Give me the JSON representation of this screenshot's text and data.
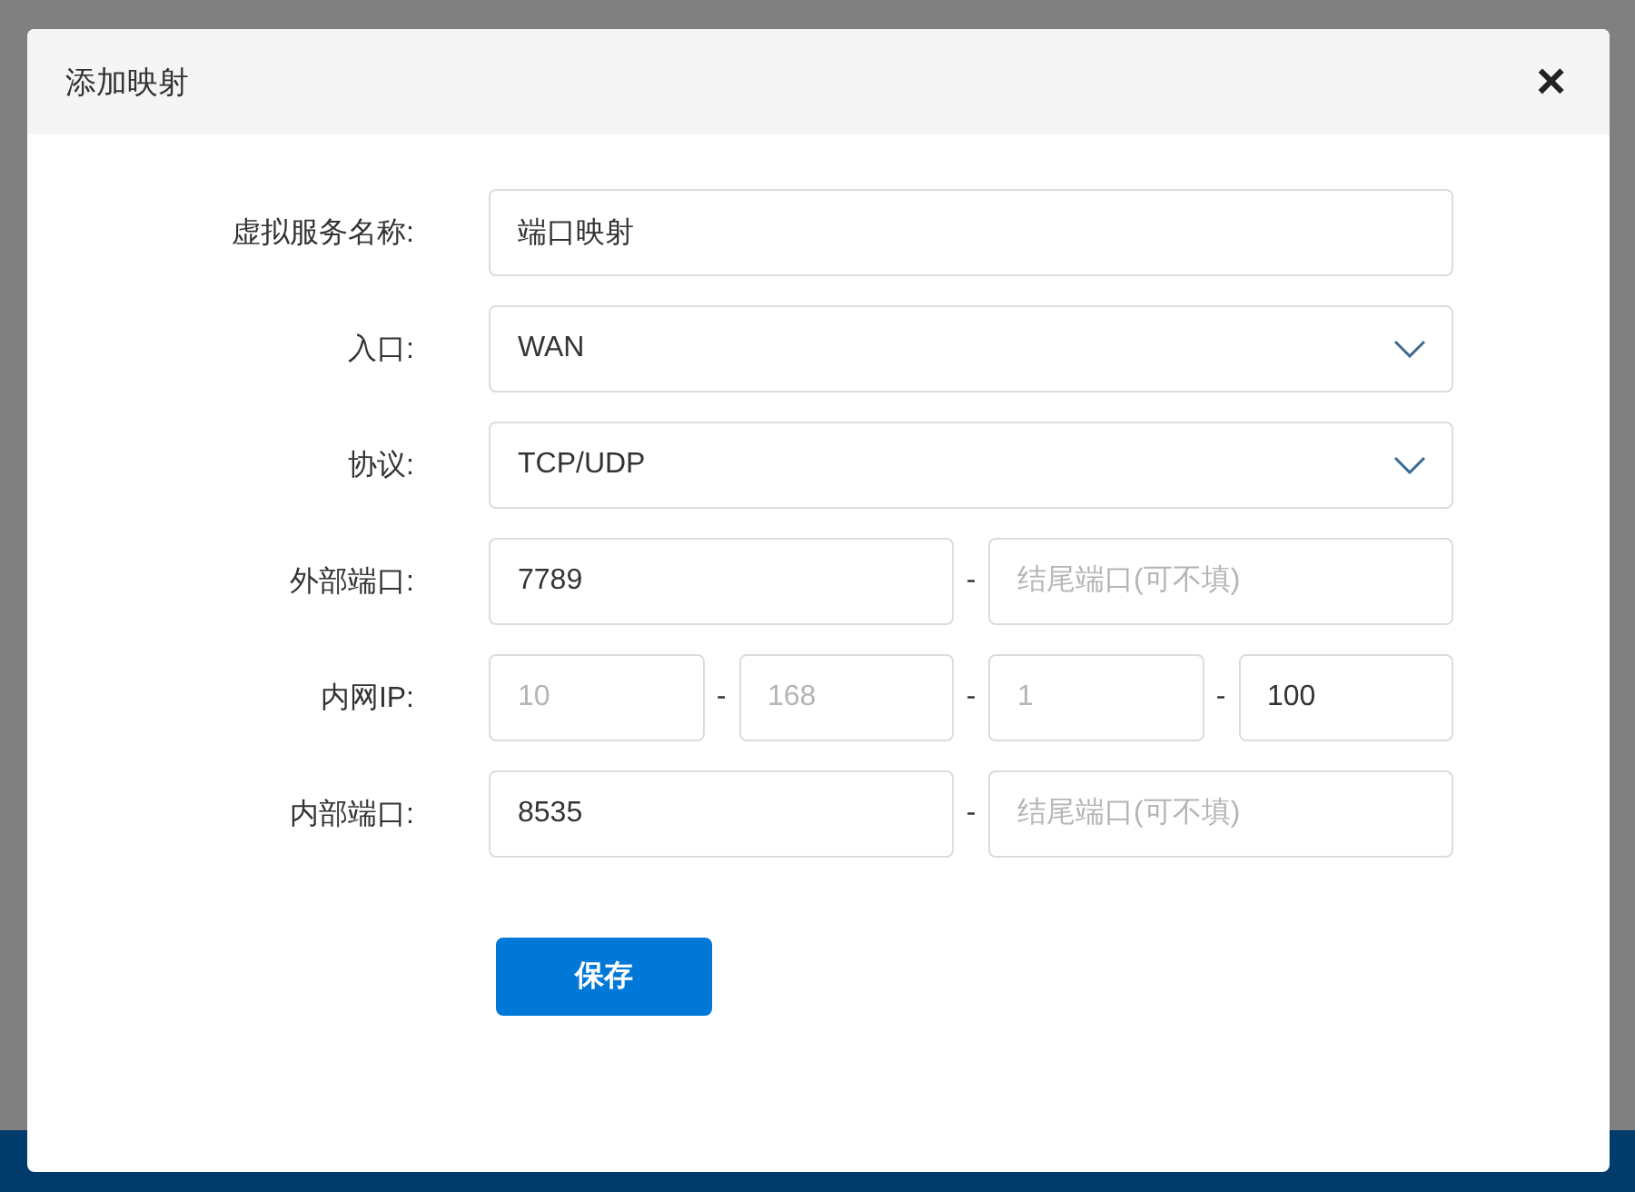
{
  "dialog": {
    "title": "添加映射",
    "close": "×"
  },
  "fields": [
    {
      "kind": "text",
      "label": "虚拟服务名称:",
      "value": "端口映射"
    },
    {
      "kind": "select",
      "label": "入口:",
      "value": "WAN"
    },
    {
      "kind": "select",
      "label": "协议:",
      "value": "TCP/UDP"
    },
    {
      "kind": "range",
      "label": "外部端口:",
      "separator": "-",
      "start": {
        "value": "7789"
      },
      "end": {
        "placeholder": "结尾端口(可不填)"
      }
    },
    {
      "kind": "ip",
      "label": "内网IP:",
      "separator": "-",
      "octets": [
        {
          "placeholder": "10"
        },
        {
          "placeholder": "168"
        },
        {
          "placeholder": "1"
        },
        {
          "value": "100"
        }
      ]
    },
    {
      "kind": "range",
      "label": "内部端口:",
      "separator": "-",
      "start": {
        "value": "8535"
      },
      "end": {
        "placeholder": "结尾端口(可不填)"
      }
    }
  ],
  "save_button": "保存"
}
